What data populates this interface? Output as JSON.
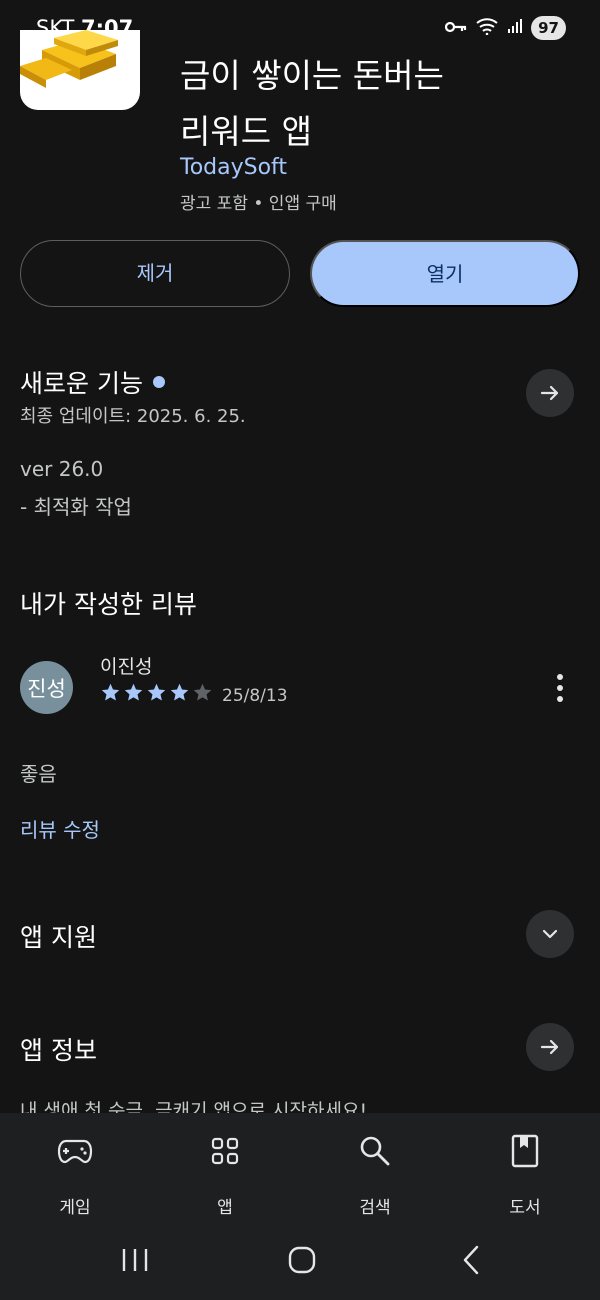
{
  "status_bar": {
    "carrier": "SKT",
    "time": "7:07",
    "battery": "97"
  },
  "app": {
    "title_line1": "금이 쌓이는 돈버는",
    "title_line2": "리워드 앱",
    "developer": "TodaySoft",
    "meta": "광고 포함 • 인앱 구매"
  },
  "actions": {
    "remove_label": "제거",
    "open_label": "열기"
  },
  "whats_new": {
    "title": "새로운 기능",
    "updated": "최종 업데이트: 2025. 6. 25.",
    "version": "ver 26.0",
    "notes": "- 최적화 작업"
  },
  "my_review": {
    "title": "내가 작성한 리뷰",
    "avatar_text": "진성",
    "reviewer": "이진성",
    "rating": 4,
    "max_rating": 5,
    "date": "25/8/13",
    "text": "좋음",
    "edit_label": "리뷰 수정"
  },
  "app_support": {
    "title": "앱 지원"
  },
  "app_info": {
    "title": "앱 정보",
    "teaser": "내 생애 첫 순금, 금캐기 앱으로 시작하세요!"
  },
  "bottom_nav": [
    {
      "label": "게임",
      "icon": "gamepad-icon"
    },
    {
      "label": "앱",
      "icon": "apps-grid-icon"
    },
    {
      "label": "검색",
      "icon": "search-icon"
    },
    {
      "label": "도서",
      "icon": "book-icon"
    }
  ],
  "colors": {
    "background": "#141414",
    "accent": "#a8c7fa",
    "star_filled": "#a8c7fa",
    "star_empty": "#5f6368"
  }
}
